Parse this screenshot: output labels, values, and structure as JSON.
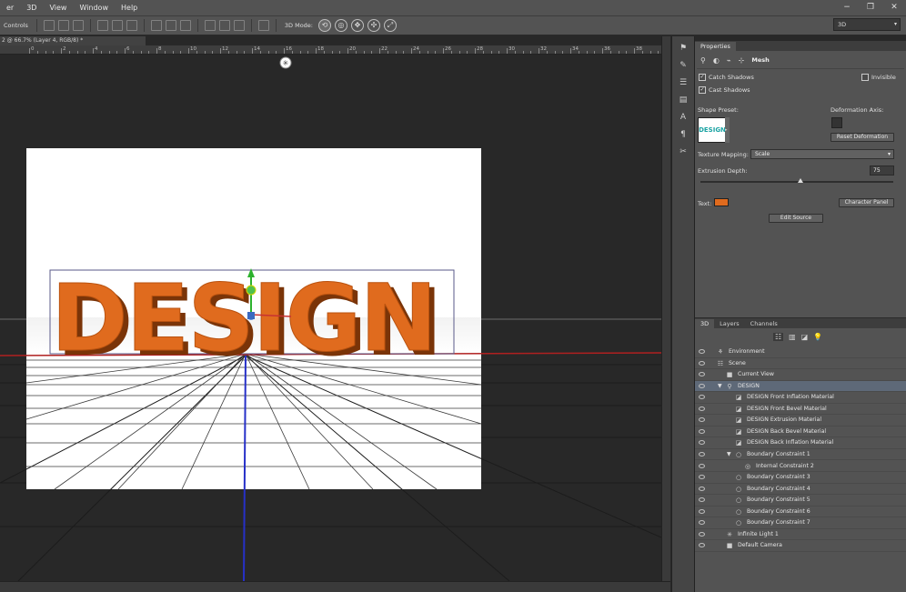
{
  "menu": [
    "er",
    "3D",
    "View",
    "Window",
    "Help"
  ],
  "window_controls": [
    "−",
    "❐",
    "✕"
  ],
  "options_bar": {
    "left_label": "Controls",
    "mode_label": "3D Mode:",
    "workspace": "3D"
  },
  "document_tab": "2 @ 66.7% (Layer 4, RGB/8) *",
  "ruler_ticks": [
    "0",
    "2",
    "4",
    "6",
    "8",
    "10",
    "12",
    "14",
    "16",
    "18",
    "20",
    "22",
    "24",
    "26",
    "28",
    "30",
    "32",
    "34",
    "36",
    "38"
  ],
  "canvas": {
    "text": "DESIGN",
    "text_color": "#e06b1e",
    "axis_color": "#2630c8"
  },
  "properties": {
    "tab": "Properties",
    "section": "Mesh",
    "catch_shadows": "Catch Shadows",
    "cast_shadows": "Cast Shadows",
    "invisible": "Invisible",
    "shape_preset": "Shape Preset:",
    "deformation_axis": "Deformation Axis:",
    "reset_deformation": "Reset Deformation",
    "texture_mapping_label": "Texture Mapping:",
    "texture_mapping_value": "Scale",
    "extrusion_depth_label": "Extrusion Depth:",
    "extrusion_depth_value": "75",
    "text_label": "Text:",
    "text_swatch": "#e06b1e",
    "character_panel": "Character Panel",
    "edit_source": "Edit Source",
    "preset_thumb_text": "DESIGN"
  },
  "layers_panel": {
    "tabs": [
      "3D",
      "Layers",
      "Channels"
    ],
    "rows": [
      {
        "name": "Environment",
        "indent": 1,
        "icon": "environment-icon"
      },
      {
        "name": "Scene",
        "indent": 1,
        "icon": "scene-icon"
      },
      {
        "name": "Current View",
        "indent": 2,
        "icon": "camera-icon"
      },
      {
        "name": "DESIGN",
        "indent": 2,
        "icon": "mesh-icon",
        "selected": true,
        "expanded": true
      },
      {
        "name": "DESIGN Front Inflation Material",
        "indent": 3,
        "icon": "material-icon"
      },
      {
        "name": "DESIGN Front Bevel Material",
        "indent": 3,
        "icon": "material-icon"
      },
      {
        "name": "DESIGN Extrusion Material",
        "indent": 3,
        "icon": "material-icon"
      },
      {
        "name": "DESIGN Back Bevel Material",
        "indent": 3,
        "icon": "material-icon"
      },
      {
        "name": "DESIGN Back Inflation Material",
        "indent": 3,
        "icon": "material-icon"
      },
      {
        "name": "Boundary Constraint 1",
        "indent": 3,
        "icon": "constraint-icon",
        "expanded": true
      },
      {
        "name": "Internal Constraint 2",
        "indent": 4,
        "icon": "internal-constraint-icon"
      },
      {
        "name": "Boundary Constraint 3",
        "indent": 3,
        "icon": "constraint-icon"
      },
      {
        "name": "Boundary Constraint 4",
        "indent": 3,
        "icon": "constraint-icon"
      },
      {
        "name": "Boundary Constraint 5",
        "indent": 3,
        "icon": "constraint-icon"
      },
      {
        "name": "Boundary Constraint 6",
        "indent": 3,
        "icon": "constraint-icon"
      },
      {
        "name": "Boundary Constraint 7",
        "indent": 3,
        "icon": "constraint-icon"
      },
      {
        "name": "Infinite Light 1",
        "indent": 2,
        "icon": "light-icon"
      },
      {
        "name": "Default Camera",
        "indent": 2,
        "icon": "camera-icon"
      }
    ]
  }
}
